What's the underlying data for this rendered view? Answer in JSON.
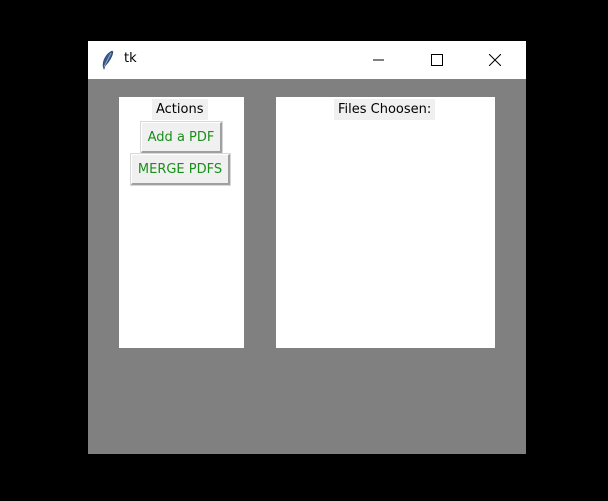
{
  "window": {
    "title": "tk"
  },
  "actions": {
    "label": "Actions",
    "add_button": "Add a PDF",
    "merge_button": "MERGE PDFS"
  },
  "files": {
    "label": "Files Choosen:"
  },
  "colors": {
    "background": "#000000",
    "window_bg": "#808080",
    "panel_bg": "#ffffff",
    "button_text": "#1a8f1a"
  },
  "icons": {
    "app": "feather-icon",
    "minimize": "minimize-icon",
    "maximize": "maximize-icon",
    "close": "close-icon"
  }
}
